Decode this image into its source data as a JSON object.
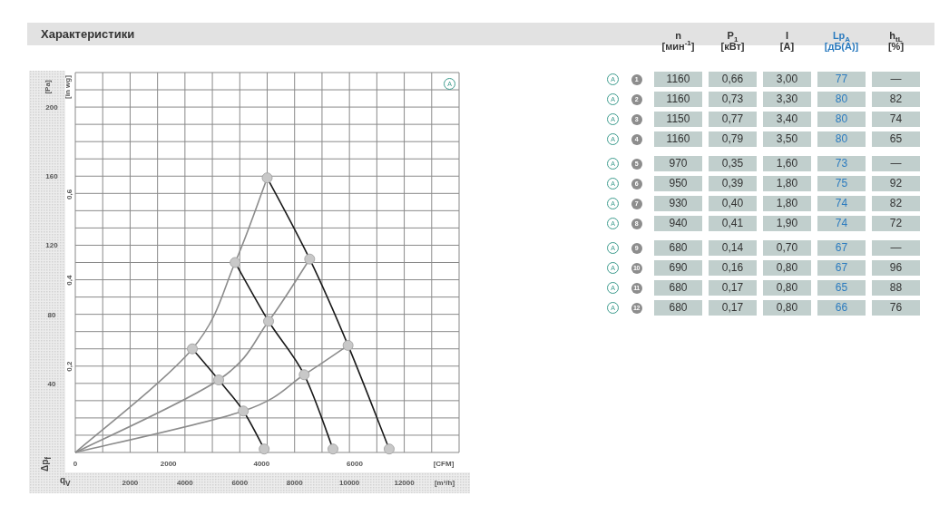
{
  "section": {
    "title": "Характеристики"
  },
  "chart": {
    "mode_badge": "A",
    "y_unit_secondary": "[in wg]",
    "y_ticks_secondary": [
      "0,2",
      "0,4",
      "0,6"
    ],
    "x_unit_secondary": "[CFM]",
    "x_ticks_secondary": [
      "0",
      "2000",
      "4000",
      "6000"
    ],
    "pressure_symbol": "Δp$_{f}$",
    "flow_symbol": "q$_{V}$",
    "chart_data": {
      "type": "line",
      "xlabel": "[m³/h]",
      "ylabel": "[Pa]",
      "xlim": [
        0,
        14000
      ],
      "ylim": [
        0,
        220
      ],
      "xticks": [
        2000,
        4000,
        6000,
        8000,
        10000,
        12000
      ],
      "grid": true,
      "yticks": [
        40,
        80,
        120,
        160,
        200
      ],
      "series": [
        {
          "color": "#1a1a1a",
          "marker": true,
          "x": [
            7000,
            8550,
            9950,
            11450
          ],
          "values": [
            159,
            112,
            62,
            2
          ]
        },
        {
          "color": "#1a1a1a",
          "marker": true,
          "x": [
            5830,
            7050,
            8350,
            9400
          ],
          "values": [
            110,
            76,
            45,
            2
          ]
        },
        {
          "color": "#1a1a1a",
          "marker": true,
          "x": [
            4270,
            5230,
            6130,
            6890
          ],
          "values": [
            60,
            42,
            24,
            2
          ]
        },
        {
          "color": "#8c8c8c",
          "x": [
            0,
            4270,
            5830,
            7000
          ],
          "values": [
            0,
            60,
            110,
            159
          ]
        },
        {
          "color": "#8c8c8c",
          "x": [
            0,
            5230,
            7050,
            8550
          ],
          "values": [
            0,
            42,
            76,
            112
          ]
        },
        {
          "color": "#8c8c8c",
          "x": [
            0,
            6130,
            8350,
            9950
          ],
          "values": [
            0,
            24,
            45,
            62
          ]
        }
      ]
    }
  },
  "table": {
    "columns": [
      {
        "label": "n",
        "unit": "[мин$^{-1}$]",
        "color": "#333333"
      },
      {
        "label": "P$_{1}$",
        "unit": "[кВт]",
        "color": "#333333"
      },
      {
        "label": "I",
        "unit": "[A]",
        "color": "#333333"
      },
      {
        "label": "Lp$_{A}$",
        "unit": "[дБ(A)]",
        "color": "#2b7bbf"
      },
      {
        "label": "h$_{tL}$",
        "unit": "[%]",
        "color": "#333333"
      }
    ],
    "groups": [
      {
        "rows": [
          {
            "mode": "A",
            "number": "1",
            "cells": [
              "1160",
              "0,66",
              "3,00",
              "77",
              "—"
            ]
          },
          {
            "mode": "A",
            "number": "2",
            "cells": [
              "1160",
              "0,73",
              "3,30",
              "80",
              "82"
            ]
          },
          {
            "mode": "A",
            "number": "3",
            "cells": [
              "1150",
              "0,77",
              "3,40",
              "80",
              "74"
            ]
          },
          {
            "mode": "A",
            "number": "4",
            "cells": [
              "1160",
              "0,79",
              "3,50",
              "80",
              "65"
            ]
          }
        ]
      },
      {
        "rows": [
          {
            "mode": "A",
            "number": "5",
            "cells": [
              "970",
              "0,35",
              "1,60",
              "73",
              "—"
            ]
          },
          {
            "mode": "A",
            "number": "6",
            "cells": [
              "950",
              "0,39",
              "1,80",
              "75",
              "92"
            ]
          },
          {
            "mode": "A",
            "number": "7",
            "cells": [
              "930",
              "0,40",
              "1,80",
              "74",
              "82"
            ]
          },
          {
            "mode": "A",
            "number": "8",
            "cells": [
              "940",
              "0,41",
              "1,90",
              "74",
              "72"
            ]
          }
        ]
      },
      {
        "rows": [
          {
            "mode": "A",
            "number": "9",
            "cells": [
              "680",
              "0,14",
              "0,70",
              "67",
              "—"
            ]
          },
          {
            "mode": "A",
            "number": "10",
            "cells": [
              "690",
              "0,16",
              "0,80",
              "67",
              "96"
            ]
          },
          {
            "mode": "A",
            "number": "11",
            "cells": [
              "680",
              "0,17",
              "0,80",
              "65",
              "88"
            ]
          },
          {
            "mode": "A",
            "number": "12",
            "cells": [
              "680",
              "0,17",
              "0,80",
              "66",
              "76"
            ]
          }
        ]
      }
    ]
  }
}
